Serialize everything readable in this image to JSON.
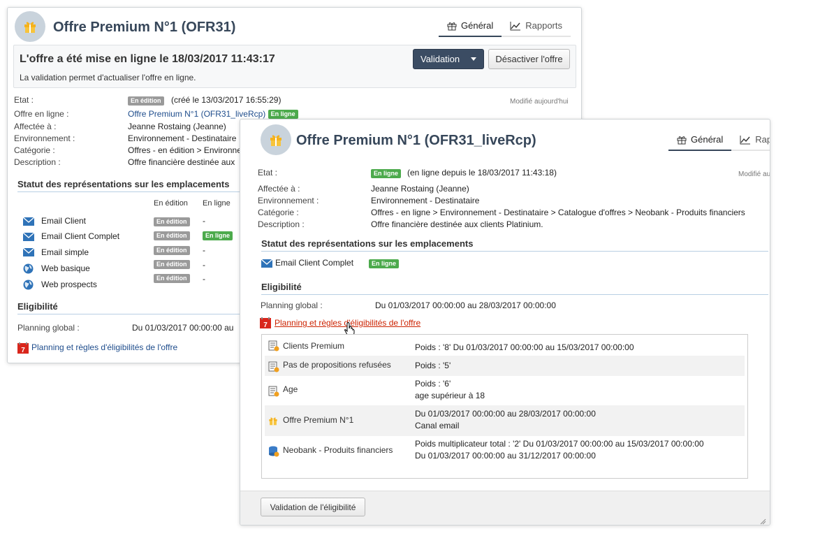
{
  "back": {
    "title": "Offre Premium N°1 (OFR31)",
    "tabs": [
      "Général",
      "Rapports"
    ],
    "online_title": "L'offre a été mise en ligne le 18/03/2017 11:43:17",
    "online_sub": "La validation permet d'actualiser l'offre en ligne.",
    "validation_btn": "Validation",
    "deactivate_btn": "Désactiver l'offre",
    "modified": "Modifié aujourd'hui",
    "fields": {
      "etat_label": "Etat :",
      "etat_badge": "En édition",
      "etat_value": "(créé le 13/03/2017 16:55:29)",
      "online_label": "Offre en ligne :",
      "online_link": "Offre Premium N°1 (OFR31_liveRcp)",
      "online_badge": "En ligne",
      "assigned_label": "Affectée à :",
      "assigned_value": "Jeanne Rostaing (Jeanne)",
      "env_label": "Environnement :",
      "env_value": "Environnement - Destinataire",
      "cat_label": "Catégorie :",
      "cat_value": "Offres - en édition > Environnement",
      "desc_label": "Description :",
      "desc_value": "Offre financière destinée aux"
    },
    "placements_title": "Statut des représentations sur les emplacements",
    "col_edition": "En édition",
    "col_online": "En ligne",
    "placements": [
      {
        "name": "Email Client",
        "edition": "En édition",
        "online": "-",
        "icon": "envelope-icon"
      },
      {
        "name": "Email Client Complet",
        "edition": "En édition",
        "online": "En ligne",
        "icon": "envelope-icon"
      },
      {
        "name": "Email simple",
        "edition": "En édition",
        "online": "-",
        "icon": "envelope-icon"
      },
      {
        "name": "Web basique",
        "edition": "En édition",
        "online": "-",
        "icon": "globe-icon"
      },
      {
        "name": "Web prospects",
        "edition": "En édition",
        "online": "-",
        "icon": "globe-icon"
      }
    ],
    "eligibility_title": "Eligibilité",
    "planning_label": "Planning global :",
    "planning_value": "Du 01/03/2017 00:00:00 au",
    "rules_link": "Planning et règles d'éligibilités de l'offre"
  },
  "front": {
    "title": "Offre Premium N°1 (OFR31_liveRcp)",
    "tabs": [
      "Général",
      "Rapports"
    ],
    "modified": "Modifié aujourd'hui",
    "fields": {
      "etat_label": "Etat :",
      "etat_badge": "En ligne",
      "etat_value": "(en ligne depuis le 18/03/2017 11:43:18)",
      "assigned_label": "Affectée à :",
      "assigned_value": "Jeanne Rostaing (Jeanne)",
      "env_label": "Environnement :",
      "env_value": "Environnement - Destinataire",
      "cat_label": "Catégorie :",
      "cat_value": "Offres - en ligne > Environnement - Destinataire > Catalogue d'offres > Neobank - Produits financiers",
      "desc_label": "Description :",
      "desc_value": "Offre financière destinée aux clients Platinium."
    },
    "placements_title": "Statut des représentations sur les emplacements",
    "placement_name": "Email Client Complet",
    "placement_badge": "En ligne",
    "eligibility_title": "Eligibilité",
    "planning_label": "Planning global :",
    "planning_value": "Du 01/03/2017 00:00:00 au 28/03/2017 00:00:00",
    "rules_link": "Planning et règles d'éligibilités de l'offre",
    "rules": [
      {
        "name": "Clients Premium",
        "icon": "rule-icon",
        "lines": [
          "Poids : '8' Du 01/03/2017 00:00:00 au 15/03/2017 00:00:00"
        ]
      },
      {
        "name": "Pas de propositions refusées",
        "icon": "rule-icon",
        "lines": [
          "Poids : '5'"
        ]
      },
      {
        "name": "Age",
        "icon": "rule-icon",
        "lines": [
          "Poids : '6'",
          "age supérieur à 18"
        ]
      },
      {
        "name": "Offre Premium N°1",
        "icon": "gift-icon",
        "lines": [
          "Du 01/03/2017 00:00:00 au 28/03/2017 00:00:00",
          "Canal email"
        ]
      },
      {
        "name": "Neobank - Produits financiers",
        "icon": "database-icon",
        "lines": [
          "Poids multiplicateur total : '2' Du 01/03/2017 00:00:00 au 15/03/2017 00:00:00",
          "Du 01/03/2017 00:00:00 au 31/12/2017 00:00:00"
        ]
      }
    ],
    "validate_btn": "Validation de l'éligibilité"
  },
  "colors": {
    "accent": "#37475a",
    "online": "#4caa4c",
    "editing": "#9a9a9a",
    "arrow": "#f0a020",
    "link_red": "#cc2200"
  }
}
